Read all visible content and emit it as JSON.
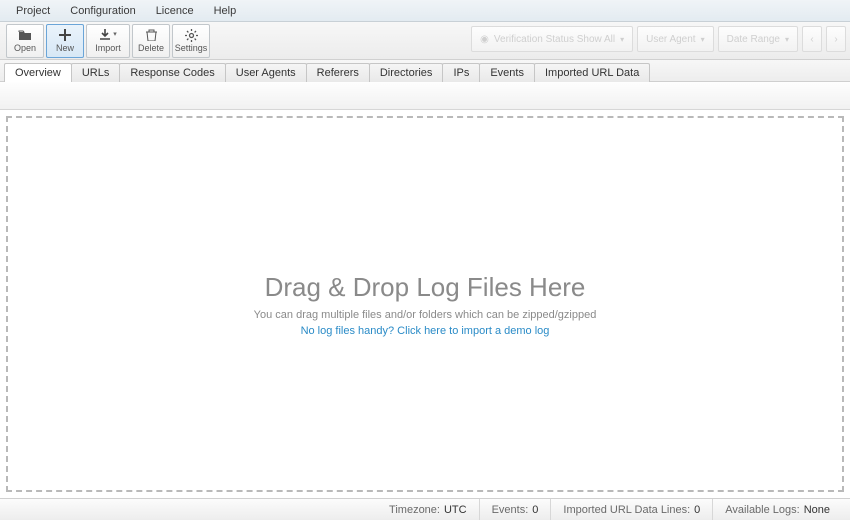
{
  "menubar": {
    "items": [
      "Project",
      "Configuration",
      "Licence",
      "Help"
    ]
  },
  "toolbar": {
    "open": {
      "label": "Open",
      "icon": "folder-open-icon"
    },
    "new": {
      "label": "New",
      "icon": "plus-icon"
    },
    "import": {
      "label": "Import",
      "icon": "download-icon"
    },
    "delete": {
      "label": "Delete",
      "icon": "trash-icon"
    },
    "settings": {
      "label": "Settings",
      "icon": "gear-icon"
    }
  },
  "filters": {
    "verification": "Verification Status Show All",
    "user_agent": "User Agent",
    "date_range": "Date Range"
  },
  "tabs": [
    "Overview",
    "URLs",
    "Response Codes",
    "User Agents",
    "Referers",
    "Directories",
    "IPs",
    "Events",
    "Imported URL Data"
  ],
  "active_tab_index": 0,
  "dropzone": {
    "title": "Drag & Drop Log Files Here",
    "subtitle": "You can drag multiple files and/or folders which can be zipped/gzipped",
    "demo_link": "No log files handy? Click here to import a demo log"
  },
  "status": {
    "timezone_label": "Timezone:",
    "timezone_value": "UTC",
    "events_label": "Events:",
    "events_value": "0",
    "imported_label": "Imported URL Data Lines:",
    "imported_value": "0",
    "available_label": "Available Logs:",
    "available_value": "None"
  }
}
